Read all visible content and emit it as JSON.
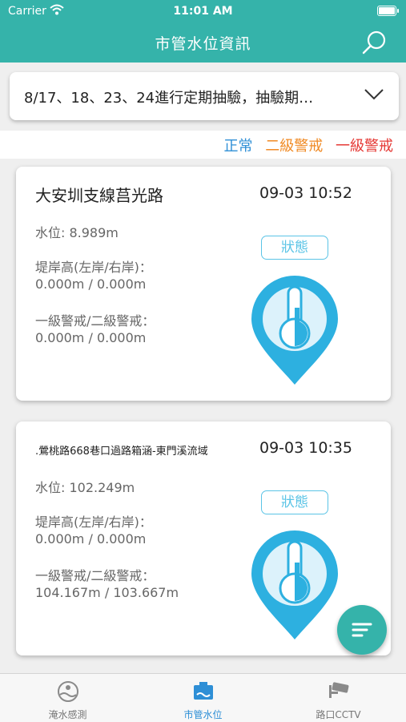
{
  "status_bar": {
    "carrier": "Carrier",
    "time": "11:01 AM"
  },
  "header": {
    "title": "市管水位資訊",
    "search_icon": "search-icon"
  },
  "notice": {
    "text": "8/17、18、23、24進行定期抽驗，抽驗期…"
  },
  "legend": [
    {
      "label": "正常",
      "color": "#2e8fd6"
    },
    {
      "label": "二級警戒",
      "color": "#f08a24"
    },
    {
      "label": "一級警戒",
      "color": "#e53935"
    }
  ],
  "cards": [
    {
      "name": "大安圳支線莒光路",
      "time": "09-03 10:52",
      "water_level": "水位:  8.989m",
      "bank_label": "堤岸高(左岸/右岸)：",
      "bank_value": "0.000m / 0.000m",
      "warn_label": "一級警戒/二級警戒：",
      "warn_value": "0.000m / 0.000m",
      "status_label": "狀態"
    },
    {
      "name": ".鶯桃路668巷口過路箱涵-東門溪流域",
      "time": "09-03 10:35",
      "water_level": "水位:  102.249m",
      "bank_label": "堤岸高(左岸/右岸)：",
      "bank_value": "0.000m / 0.000m",
      "warn_label": "一級警戒/二級警戒：",
      "warn_value": "104.167m / 103.667m",
      "status_label": "狀態"
    }
  ],
  "tabs": [
    {
      "label": "淹水感測",
      "icon": "flood-sensor-icon",
      "active": false
    },
    {
      "label": "市管水位",
      "icon": "water-level-icon",
      "active": true
    },
    {
      "label": "路口CCTV",
      "icon": "cctv-camera-icon",
      "active": false
    }
  ],
  "colors": {
    "primary": "#35b3aa",
    "active_tab": "#2e8fd6",
    "status_accent": "#5bc4e6"
  }
}
